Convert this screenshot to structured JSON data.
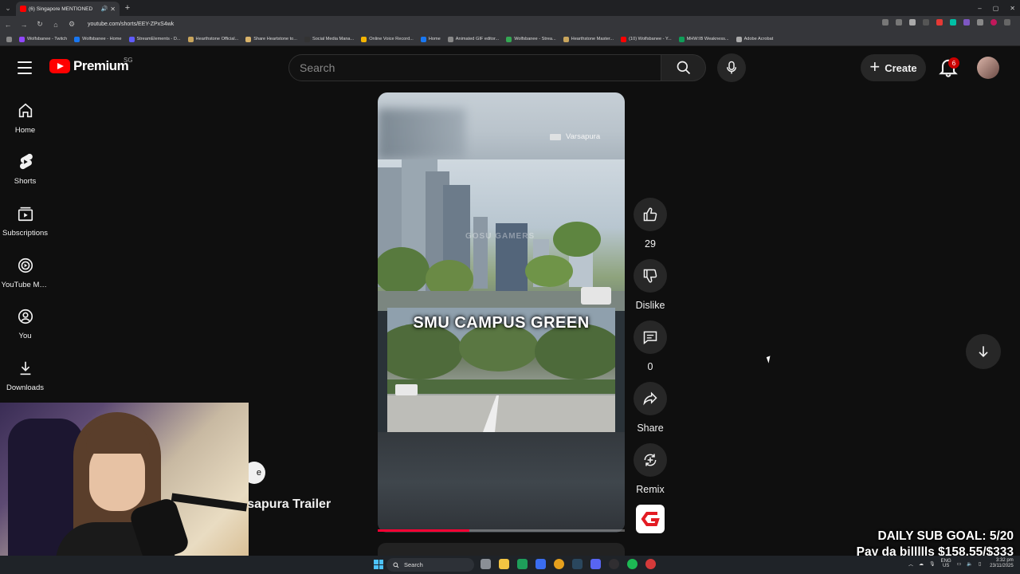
{
  "browser": {
    "tab_title": "(6) Singapore MENTIONED",
    "new_tab": "+",
    "url": "youtube.com/shorts/EEY-ZPxS4wk",
    "window_controls": [
      "–",
      "▢",
      "✕"
    ],
    "bookmarks": [
      {
        "label": "Wolfsbanee - Twitch",
        "color": "#9146ff"
      },
      {
        "label": "Wolfsbanee - Home",
        "color": "#1877f2"
      },
      {
        "label": "StreamElements - D...",
        "color": "#5f5bff"
      },
      {
        "label": "Hearthstone Official...",
        "color": "#c9a55c"
      },
      {
        "label": "Share Heartstone to...",
        "color": "#d9b36a"
      },
      {
        "label": "Social Media Mana...",
        "color": "#333333"
      },
      {
        "label": "Online Voice Record...",
        "color": "#f4b400"
      },
      {
        "label": "Home",
        "color": "#1877f2"
      },
      {
        "label": "Animated GIF editor...",
        "color": "#888888"
      },
      {
        "label": "Wolfsbanee - Strea...",
        "color": "#34a853"
      },
      {
        "label": "Hearthstone Master...",
        "color": "#c9a55c"
      },
      {
        "label": "(10) Wolfsbanee - Y...",
        "color": "#ff0000"
      },
      {
        "label": "MHW:IB Weakness...",
        "color": "#0f9d58"
      },
      {
        "label": "Adobe Acrobat",
        "color": "#aaaaaa"
      }
    ]
  },
  "header": {
    "logo_text": "Premium",
    "region": "SG",
    "search_placeholder": "Search",
    "create_label": "Create",
    "notification_count": "6"
  },
  "sidebar": {
    "items": [
      {
        "label": "Home",
        "icon": "home-icon"
      },
      {
        "label": "Shorts",
        "icon": "shorts-icon"
      },
      {
        "label": "Subscriptions",
        "icon": "subscriptions-icon"
      },
      {
        "label": "YouTube Mu...",
        "icon": "youtube-music-icon"
      },
      {
        "label": "You",
        "icon": "you-icon"
      },
      {
        "label": "Downloads",
        "icon": "downloads-icon"
      }
    ]
  },
  "short": {
    "channel_tag": "Varsapura",
    "overlay_title": "SMU CAMPUS GREEN",
    "watermark": "GOSU GAMERS",
    "progress": 0.37,
    "partial_title": "rsapura Trailer",
    "partial_chip": "e"
  },
  "actions": {
    "like_count": "29",
    "dislike_label": "Dislike",
    "comment_count": "0",
    "share_label": "Share",
    "remix_label": "Remix"
  },
  "stream_overlay": {
    "goal_line1": "DAILY SUB GOAL: 5/20",
    "goal_line2": "Pay da billllls $158.55/$333"
  },
  "taskbar": {
    "search_label": "Search",
    "lang_top": "ENG",
    "lang_bottom": "US",
    "time": "3:32 pm",
    "date": "23/11/2025"
  },
  "colors": {
    "background": "#0f0f0f",
    "accent_red": "#ff0000",
    "progress_red": "#ff0033",
    "button_bg": "#272727"
  }
}
